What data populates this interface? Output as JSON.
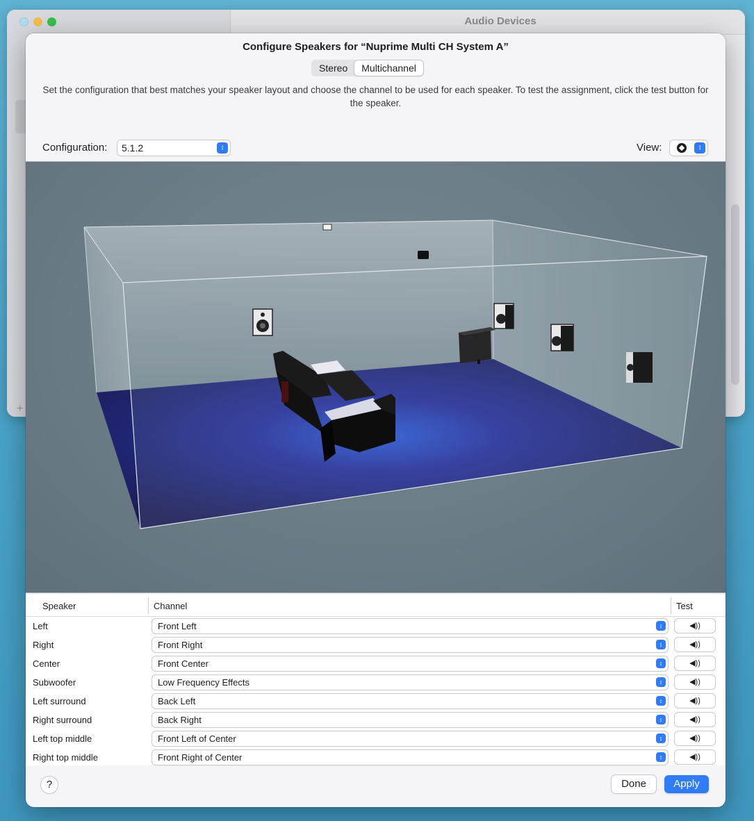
{
  "background_window": {
    "title": "Audio Devices",
    "add_label": "+"
  },
  "sheet": {
    "title": "Configure Speakers for “Nuprime Multi CH System A”",
    "tabs": [
      {
        "label": "Stereo",
        "active": false
      },
      {
        "label": "Multichannel",
        "active": true
      }
    ],
    "description": "Set the configuration that best matches your speaker layout and choose the channel to be used for each speaker. To test the assignment, click the test button for the speaker.",
    "configuration": {
      "label": "Configuration:",
      "value": "5.1.2"
    },
    "view": {
      "label": "View:",
      "icon": "3d-cube-icon"
    }
  },
  "table": {
    "headers": {
      "speaker": "Speaker",
      "channel": "Channel",
      "test": "Test"
    },
    "rows": [
      {
        "speaker": "Left",
        "channel": "Front Left"
      },
      {
        "speaker": "Right",
        "channel": "Front Right"
      },
      {
        "speaker": "Center",
        "channel": "Front Center"
      },
      {
        "speaker": "Subwoofer",
        "channel": "Low Frequency Effects"
      },
      {
        "speaker": "Left surround",
        "channel": "Back Left"
      },
      {
        "speaker": "Right surround",
        "channel": "Back Right"
      },
      {
        "speaker": "Left top middle",
        "channel": "Front Left of Center"
      },
      {
        "speaker": "Right top middle",
        "channel": "Front Right of Center"
      }
    ],
    "test_icon": "speaker-volume-icon",
    "test_glyph": "◀))"
  },
  "footer": {
    "help": "?",
    "done": "Done",
    "apply": "Apply"
  },
  "colors": {
    "accent": "#2f7cf6",
    "floor": "#2a2f8a",
    "viewport_bg": "#6e7f8a"
  }
}
